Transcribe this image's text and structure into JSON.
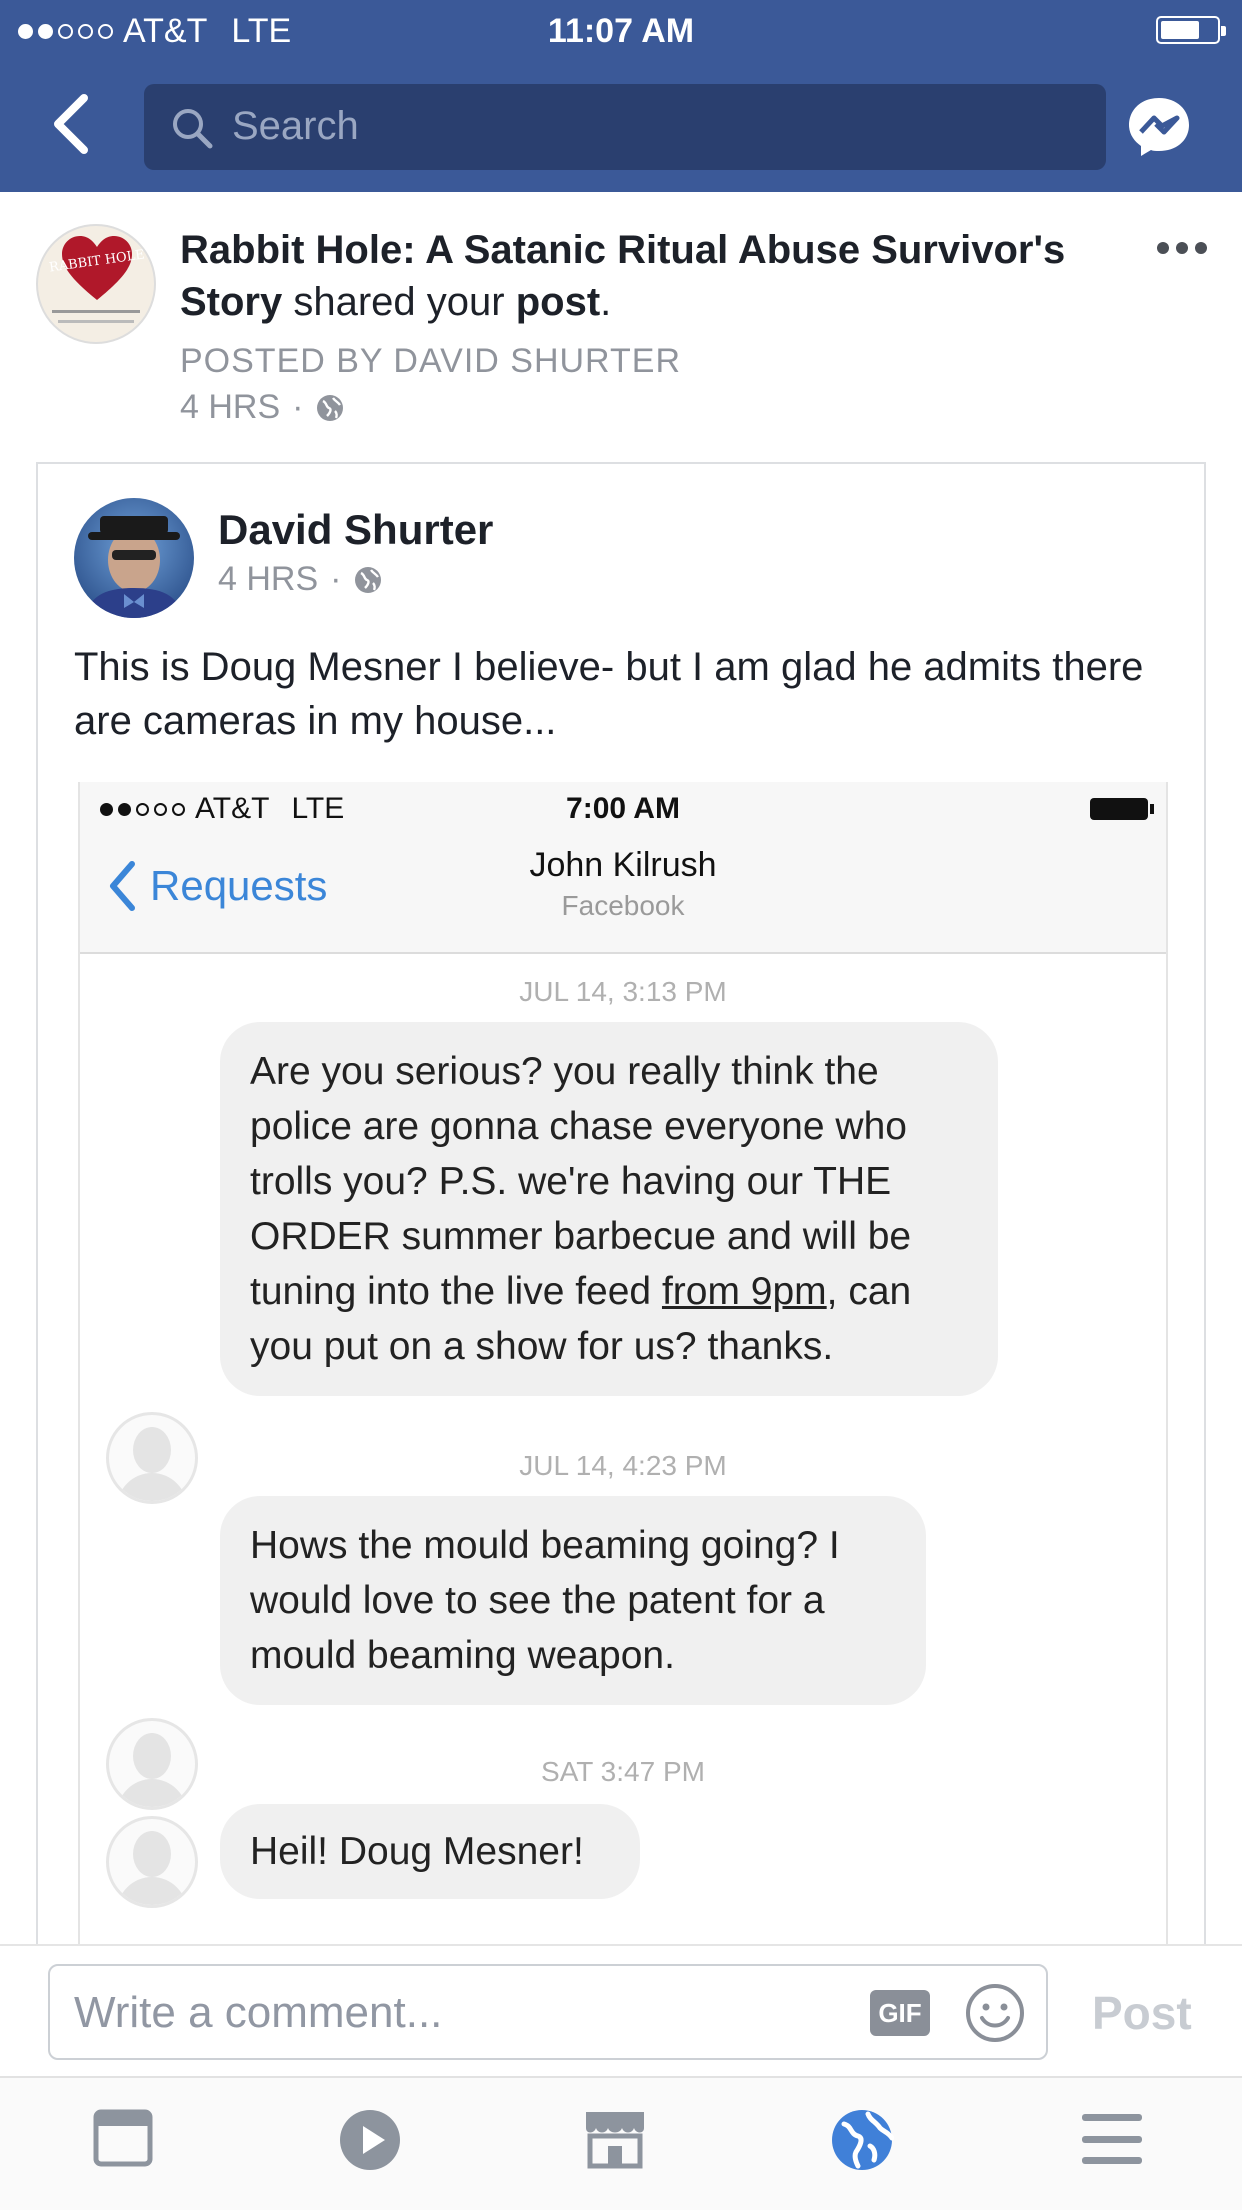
{
  "status_bar": {
    "carrier": "AT&T",
    "network": "LTE",
    "time": "11:07 AM"
  },
  "search": {
    "placeholder": "Search"
  },
  "notification": {
    "page_name": "Rabbit Hole: A Satanic Ritual Abuse Survivor's Story",
    "action_mid": " shared your ",
    "action_object": "post",
    "action_end": ".",
    "posted_by": "POSTED BY DAVID SHURTER",
    "time": "4 HRS",
    "separator": "·",
    "avatar_text": "RABBIT HOLE"
  },
  "post": {
    "author": "David Shurter",
    "time": "4 HRS",
    "separator": "·",
    "text": "This is Doug Mesner I believe- but I am glad he admits there are cameras in my house..."
  },
  "embedded_screenshot": {
    "carrier": "AT&T",
    "network": "LTE",
    "time": "7:00 AM",
    "back_label": "Requests",
    "contact_name": "John Kilrush",
    "contact_source": "Facebook",
    "messages": [
      {
        "timestamp": "JUL 14, 3:13 PM",
        "text_before": "Are you serious? you really think the police are gonna chase everyone who trolls you? P.S. we're having our THE ORDER summer barbecue and will be tuning into the live feed ",
        "text_underlined": "from 9pm",
        "text_after": ", can you put on a show for us? thanks."
      },
      {
        "timestamp": "JUL 14, 4:23 PM",
        "text": "Hows the mould beaming going? I would love to see the patent for a mould beaming weapon."
      },
      {
        "timestamp": "SAT 3:47 PM",
        "text": "Heil! Doug Mesner!"
      }
    ]
  },
  "comment_bar": {
    "placeholder": "Write a comment...",
    "gif_label": "GIF",
    "post_label": "Post"
  },
  "tabs": [
    "news-feed-icon",
    "video-icon",
    "marketplace-icon",
    "notifications-globe-icon",
    "menu-icon"
  ],
  "colors": {
    "facebook_blue": "#3b5998",
    "accent_blue": "#4080d8",
    "meta_gray": "#90949c"
  }
}
